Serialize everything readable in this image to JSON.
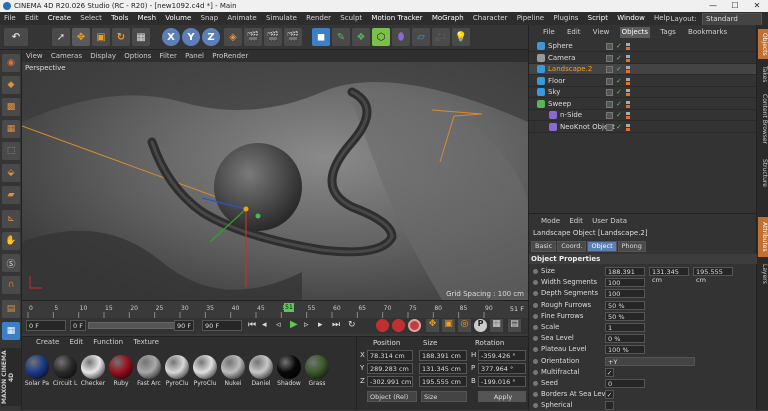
{
  "window": {
    "title": "CINEMA 4D R20.026 Studio (RC - R20) - [new1092.c4d *] - Main",
    "minimize": "—",
    "maximize": "☐",
    "close": "✕"
  },
  "menubar": {
    "items": [
      "File",
      "Edit",
      "Create",
      "Select",
      "Tools",
      "Mesh",
      "Volume",
      "Snap",
      "Animate",
      "Simulate",
      "Render",
      "Sculpt",
      "Motion Tracker",
      "MoGraph",
      "Character",
      "Pipeline",
      "Plugins",
      "Script",
      "Window",
      "Help"
    ],
    "layout_label": "Layout:",
    "layout_value": "Standard"
  },
  "toolbar": {
    "axis_x": "X",
    "axis_y": "Y",
    "axis_z": "Z"
  },
  "viewport": {
    "menu": [
      "View",
      "Cameras",
      "Display",
      "Options",
      "Filter",
      "Panel",
      "ProRender"
    ],
    "label": "Perspective",
    "grid_spacing": "Grid Spacing : 100 cm"
  },
  "timeline": {
    "ticks": [
      "0",
      "5",
      "10",
      "15",
      "20",
      "25",
      "30",
      "35",
      "40",
      "45",
      "50",
      "55",
      "60",
      "65",
      "70",
      "75",
      "80",
      "85",
      "90"
    ],
    "current_marker": "51",
    "end_label": "51 F",
    "start_field": "0 F",
    "min_field": "0 F",
    "max_field": "90 F",
    "end_field": "90 F"
  },
  "material_manager": {
    "menu": [
      "Create",
      "Edit",
      "Function",
      "Texture"
    ],
    "materials": [
      {
        "name": "Solar Pa",
        "color": "#1a3a8a"
      },
      {
        "name": "Circuit L",
        "color": "#2a2a2a"
      },
      {
        "name": "Checker",
        "color": "#e8e8e8"
      },
      {
        "name": "Ruby",
        "color": "#9a1020"
      },
      {
        "name": "Fast Arc",
        "color": "#a8a8a8"
      },
      {
        "name": "PyroClu",
        "color": "#d8d8d8"
      },
      {
        "name": "PyroClu",
        "color": "#e0e0e0"
      },
      {
        "name": "Nukei",
        "color": "#bcbcbc"
      },
      {
        "name": "Daniel",
        "color": "#c8c8c8"
      },
      {
        "name": "Shadow",
        "color": "#080808"
      },
      {
        "name": "Grass",
        "color": "#3a5a2a"
      }
    ]
  },
  "coordinates": {
    "headers": [
      "Position",
      "Size",
      "Rotation"
    ],
    "rows": [
      {
        "axis": "X",
        "pos": "78.314 cm",
        "size": "188.391 cm",
        "rot_axis": "H",
        "rot": "-359.426 °"
      },
      {
        "axis": "Y",
        "pos": "289.283 cm",
        "size": "131.345 cm",
        "rot_axis": "P",
        "rot": "377.964 °"
      },
      {
        "axis": "Z",
        "pos": "-302.991 cm",
        "size": "195.555 cm",
        "rot_axis": "B",
        "rot": "-199.016 °"
      }
    ],
    "mode": "Object (Rel)",
    "size_mode": "Size",
    "apply": "Apply"
  },
  "object_manager": {
    "menu": [
      "File",
      "Edit",
      "View",
      "Objects",
      "Tags",
      "Bookmarks"
    ],
    "active_menu": "Objects",
    "objects": [
      {
        "name": "Sphere",
        "selected": false,
        "icon_color": "#3a9ad9"
      },
      {
        "name": "Camera",
        "selected": false,
        "icon_color": "#999999"
      },
      {
        "name": "Landscape.2",
        "selected": true,
        "icon_color": "#3a9ad9"
      },
      {
        "name": "Floor",
        "selected": false,
        "icon_color": "#3a9ad9"
      },
      {
        "name": "Sky",
        "selected": false,
        "icon_color": "#3a9ad9"
      },
      {
        "name": "Sweep",
        "selected": false,
        "icon_color": "#58b858"
      },
      {
        "name": "n-Side",
        "selected": false,
        "icon_color": "#8a6ad0"
      },
      {
        "name": "NeoKnot Object",
        "selected": false,
        "icon_color": "#8a6ad0"
      }
    ]
  },
  "attribute_manager": {
    "menu": [
      "Mode",
      "Edit",
      "User Data"
    ],
    "title": "Landscape Object [Landscape.2]",
    "tabs": [
      "Basic",
      "Coord.",
      "Object",
      "Phong"
    ],
    "active_tab": "Object",
    "section": "Object Properties",
    "properties": [
      {
        "label": "Size",
        "value": "188.391 cm",
        "value2": "131.345 cm",
        "value3": "195.555 cm"
      },
      {
        "label": "Width Segments",
        "value": "100"
      },
      {
        "label": "Depth Segments",
        "value": "100"
      },
      {
        "label": "Rough Furrows",
        "value": "50 %"
      },
      {
        "label": "Fine Furrows",
        "value": "50 %"
      },
      {
        "label": "Scale",
        "value": "1"
      },
      {
        "label": "Sea Level",
        "value": "0 %"
      },
      {
        "label": "Plateau Level",
        "value": "100 %"
      },
      {
        "label": "Orientation",
        "value": "+Y"
      },
      {
        "label": "Multifractal",
        "value": "✓"
      },
      {
        "label": "Seed",
        "value": "0"
      },
      {
        "label": "Borders At Sea Level",
        "value": "✓"
      },
      {
        "label": "Spherical",
        "value": ""
      }
    ]
  },
  "side_tabs": [
    "Objects",
    "Takes",
    "Content Browser",
    "Structure",
    "Attributes",
    "Layers"
  ],
  "colors": {
    "accent_blue": "#5c7fb8",
    "selection_orange": "#f0a020",
    "check_green": "#59c95a"
  }
}
